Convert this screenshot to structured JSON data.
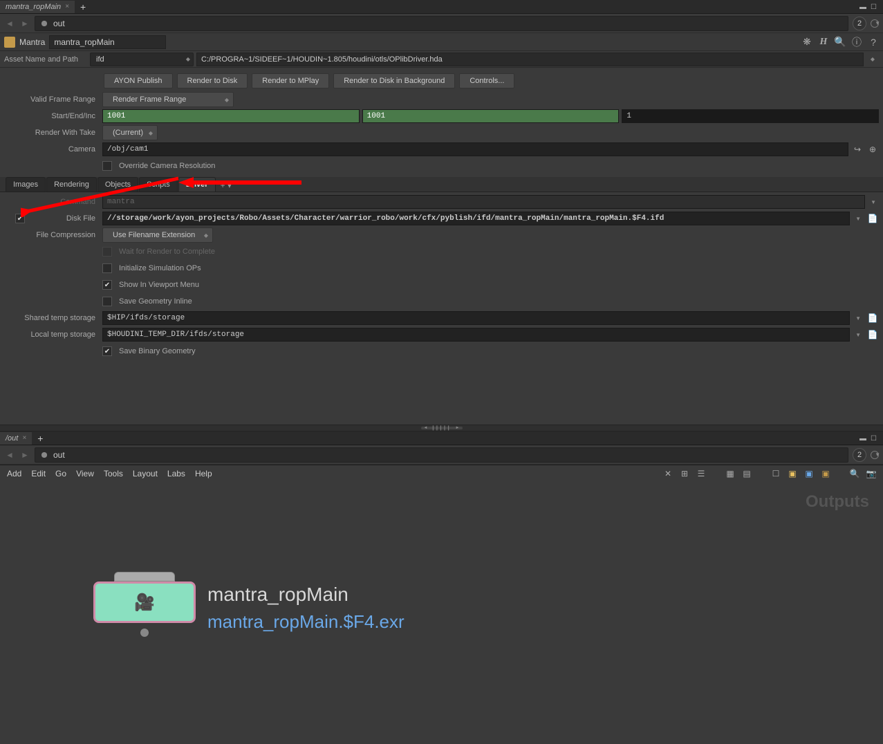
{
  "topTab": {
    "label": "mantra_ropMain"
  },
  "navPath": "out",
  "navBadge": "2",
  "nodeHeader": {
    "type": "Mantra",
    "name": "mantra_ropMain"
  },
  "asset": {
    "label": "Asset Name and Path",
    "name": "ifd",
    "path": "C:/PROGRA~1/SIDEEF~1/HOUDIN~1.805/houdini/otls/OPlibDriver.hda"
  },
  "buttons": {
    "ayon": "AYON Publish",
    "rtd": "Render to Disk",
    "rtm": "Render to MPlay",
    "rtdbg": "Render to Disk in Background",
    "ctrl": "Controls..."
  },
  "params": {
    "validFrame_label": "Valid Frame Range",
    "validFrame_value": "Render Frame Range",
    "startEnd_label": "Start/End/Inc",
    "start": "1001",
    "end": "1001",
    "inc": "1",
    "take_label": "Render With Take",
    "take": "(Current)",
    "camera_label": "Camera",
    "camera": "/obj/cam1",
    "override": "Override Camera Resolution"
  },
  "tabs": {
    "images": "Images",
    "rendering": "Rendering",
    "objects": "Objects",
    "scripts": "Scripts",
    "driver": "Driver"
  },
  "driver": {
    "command_label": "Command",
    "command": "mantra",
    "diskfile_label": "Disk File",
    "diskfile": "//storage/work/ayon_projects/Robo/Assets/Character/warrior_robo/work/cfx/pyblish/ifd/mantra_ropMain/mantra_ropMain.$F4.ifd",
    "filecomp_label": "File Compression",
    "filecomp": "Use Filename Extension",
    "wait": "Wait for Render to Complete",
    "initsim": "Initialize Simulation OPs",
    "viewport": "Show In Viewport Menu",
    "savegeo": "Save Geometry Inline",
    "shared_label": "Shared temp storage",
    "shared": "$HIP/ifds/storage",
    "local_label": "Local temp storage",
    "local": "$HOUDINI_TEMP_DIR/ifds/storage",
    "savebin": "Save Binary Geometry"
  },
  "lowerTab": {
    "label": "/out"
  },
  "lowerNavPath": "out",
  "lowerBadge": "2",
  "menus": [
    "Add",
    "Edit",
    "Go",
    "View",
    "Tools",
    "Layout",
    "Labs",
    "Help"
  ],
  "outputsLabel": "Outputs",
  "nodeGraphic": {
    "title": "mantra_ropMain",
    "sub": "mantra_ropMain.$F4.exr"
  }
}
